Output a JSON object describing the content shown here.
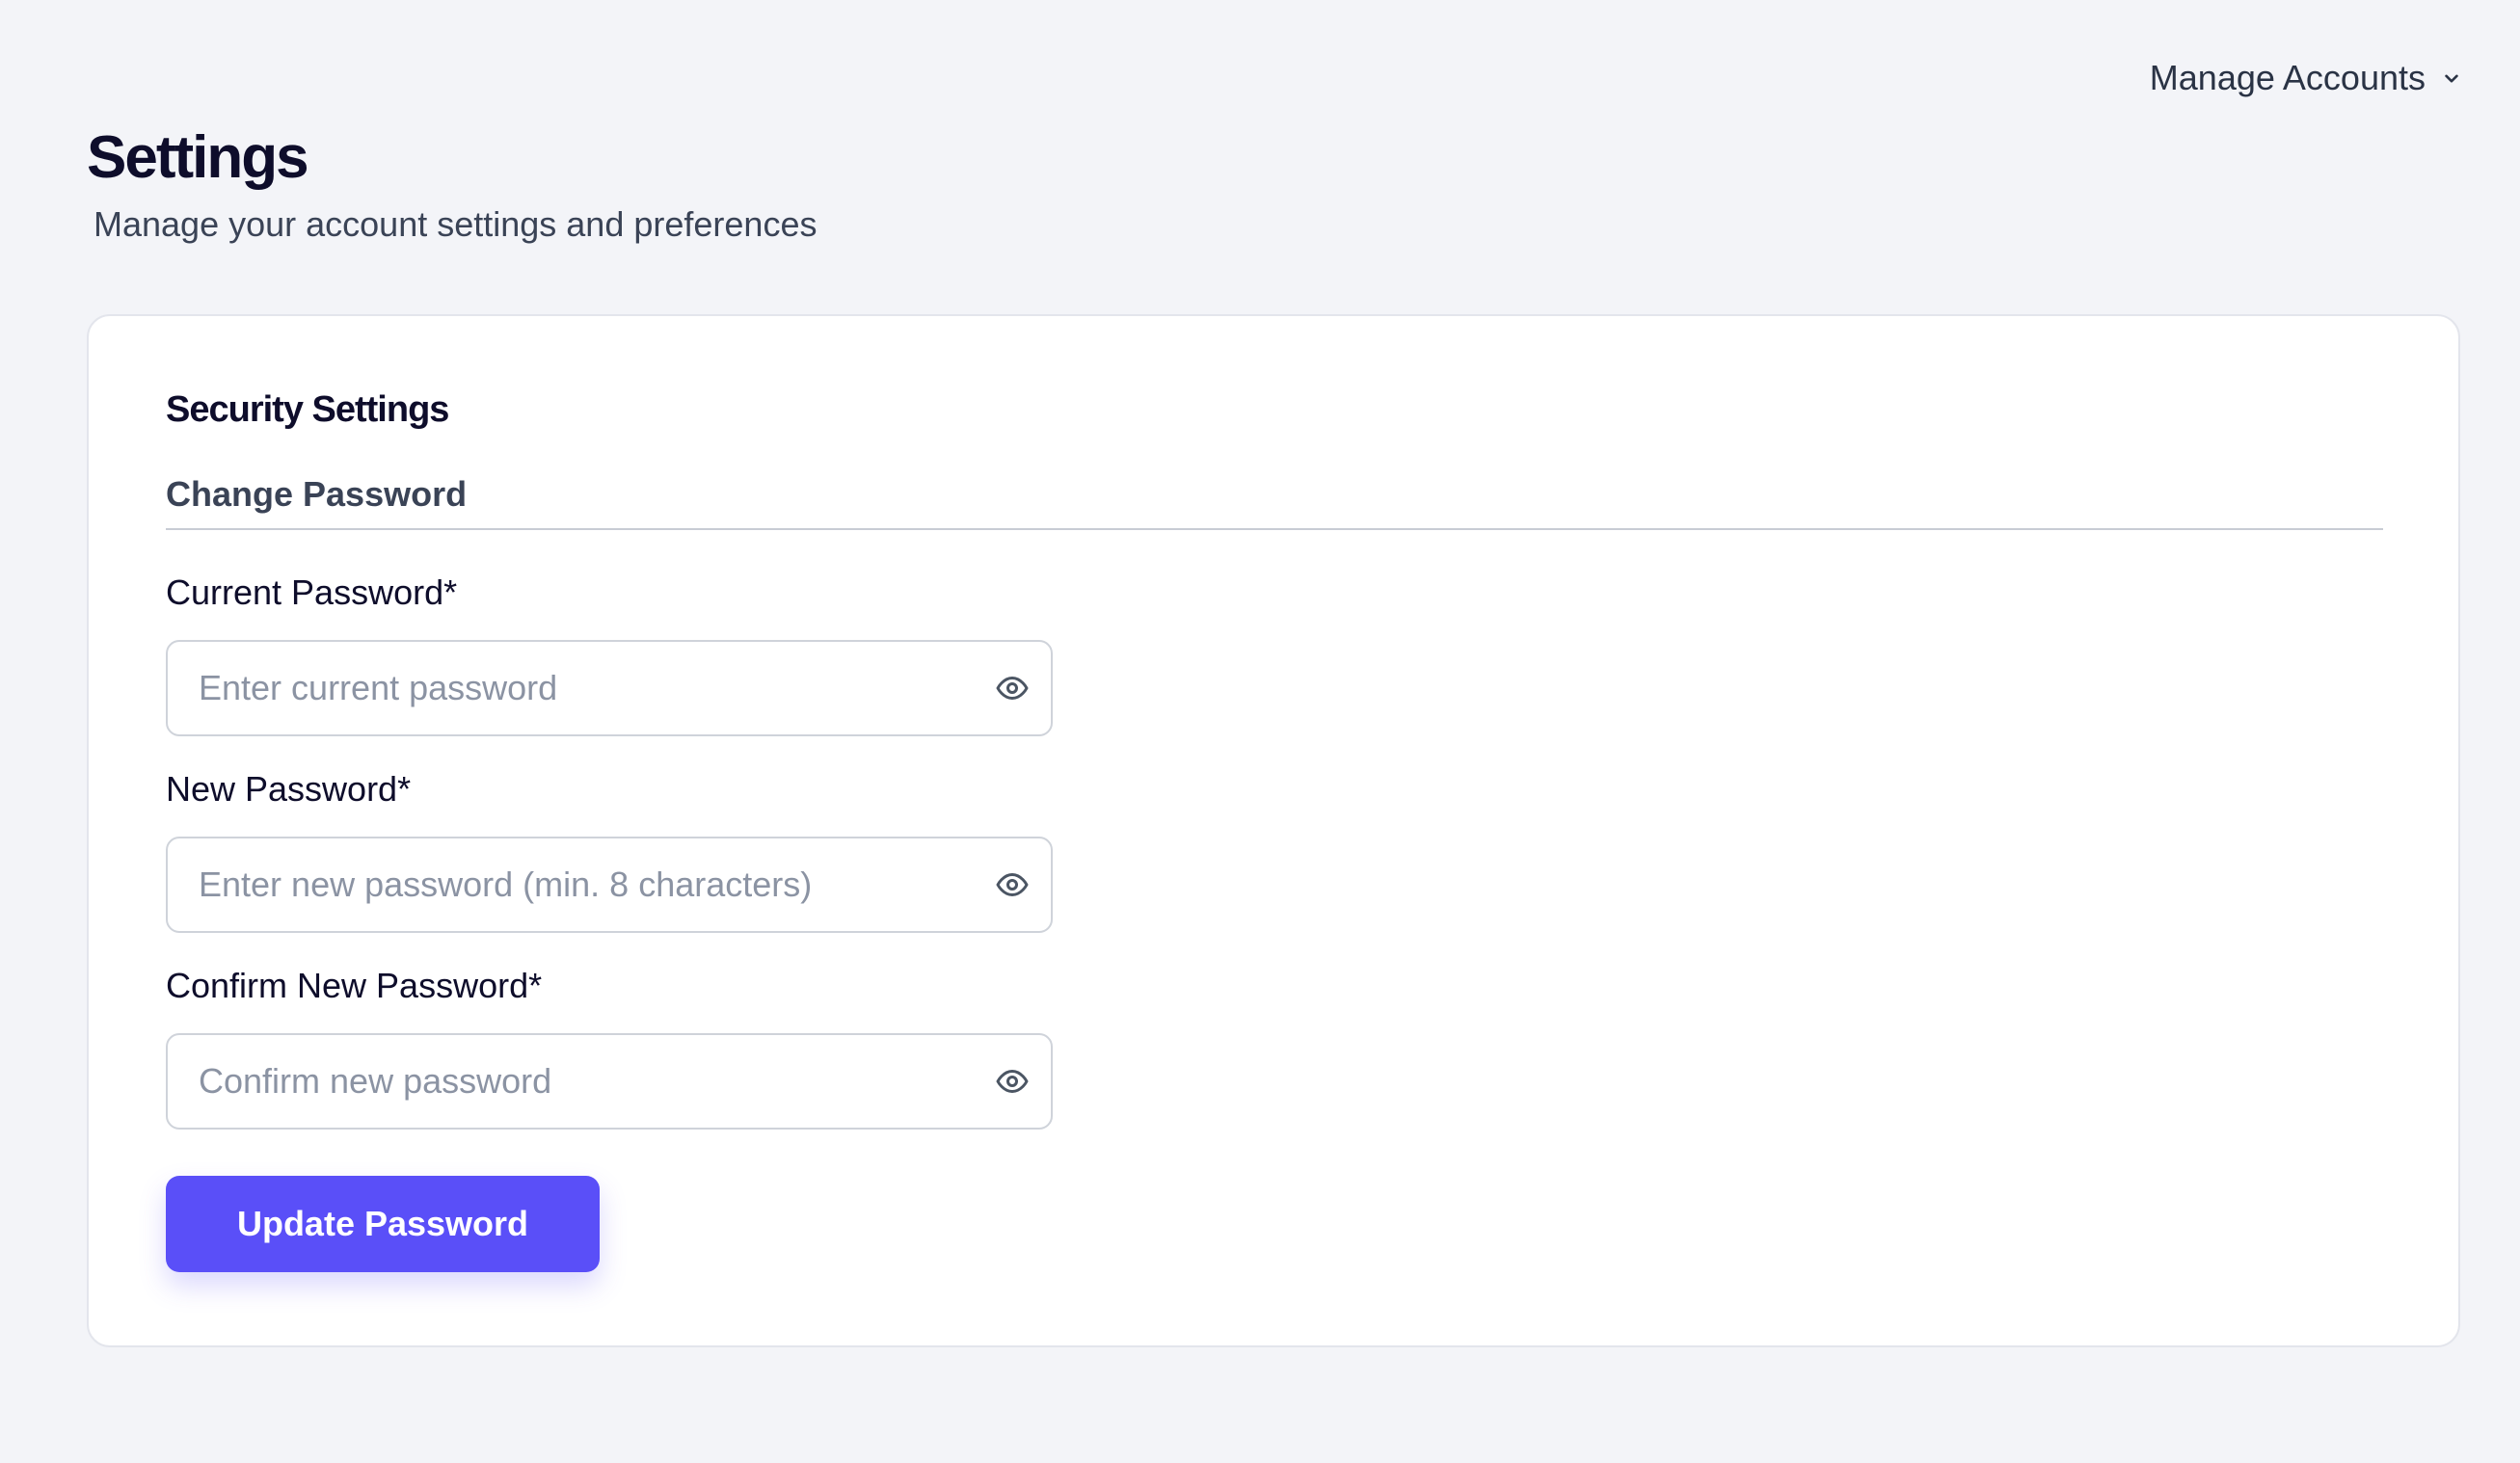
{
  "header": {
    "manage_accounts_label": "Manage Accounts",
    "manage_accounts_icon": "chevron-down-icon"
  },
  "page": {
    "title": "Settings",
    "subtitle": "Manage your account settings and preferences"
  },
  "security": {
    "title": "Security Settings",
    "section_title": "Change Password",
    "fields": [
      {
        "label": "Current Password*",
        "placeholder": "Enter current password",
        "value": "",
        "icon": "eye-icon"
      },
      {
        "label": "New Password*",
        "placeholder": "Enter new password (min. 8 characters)",
        "value": "",
        "icon": "eye-icon"
      },
      {
        "label": "Confirm New Password*",
        "placeholder": "Confirm new password",
        "value": "",
        "icon": "eye-icon"
      }
    ],
    "submit_label": "Update Password"
  },
  "colors": {
    "background": "#f3f4f8",
    "card": "#ffffff",
    "accent": "#5a4ff8",
    "heading": "#0e0d2b",
    "muted_text": "#3a4356",
    "placeholder": "#8b93a3"
  }
}
